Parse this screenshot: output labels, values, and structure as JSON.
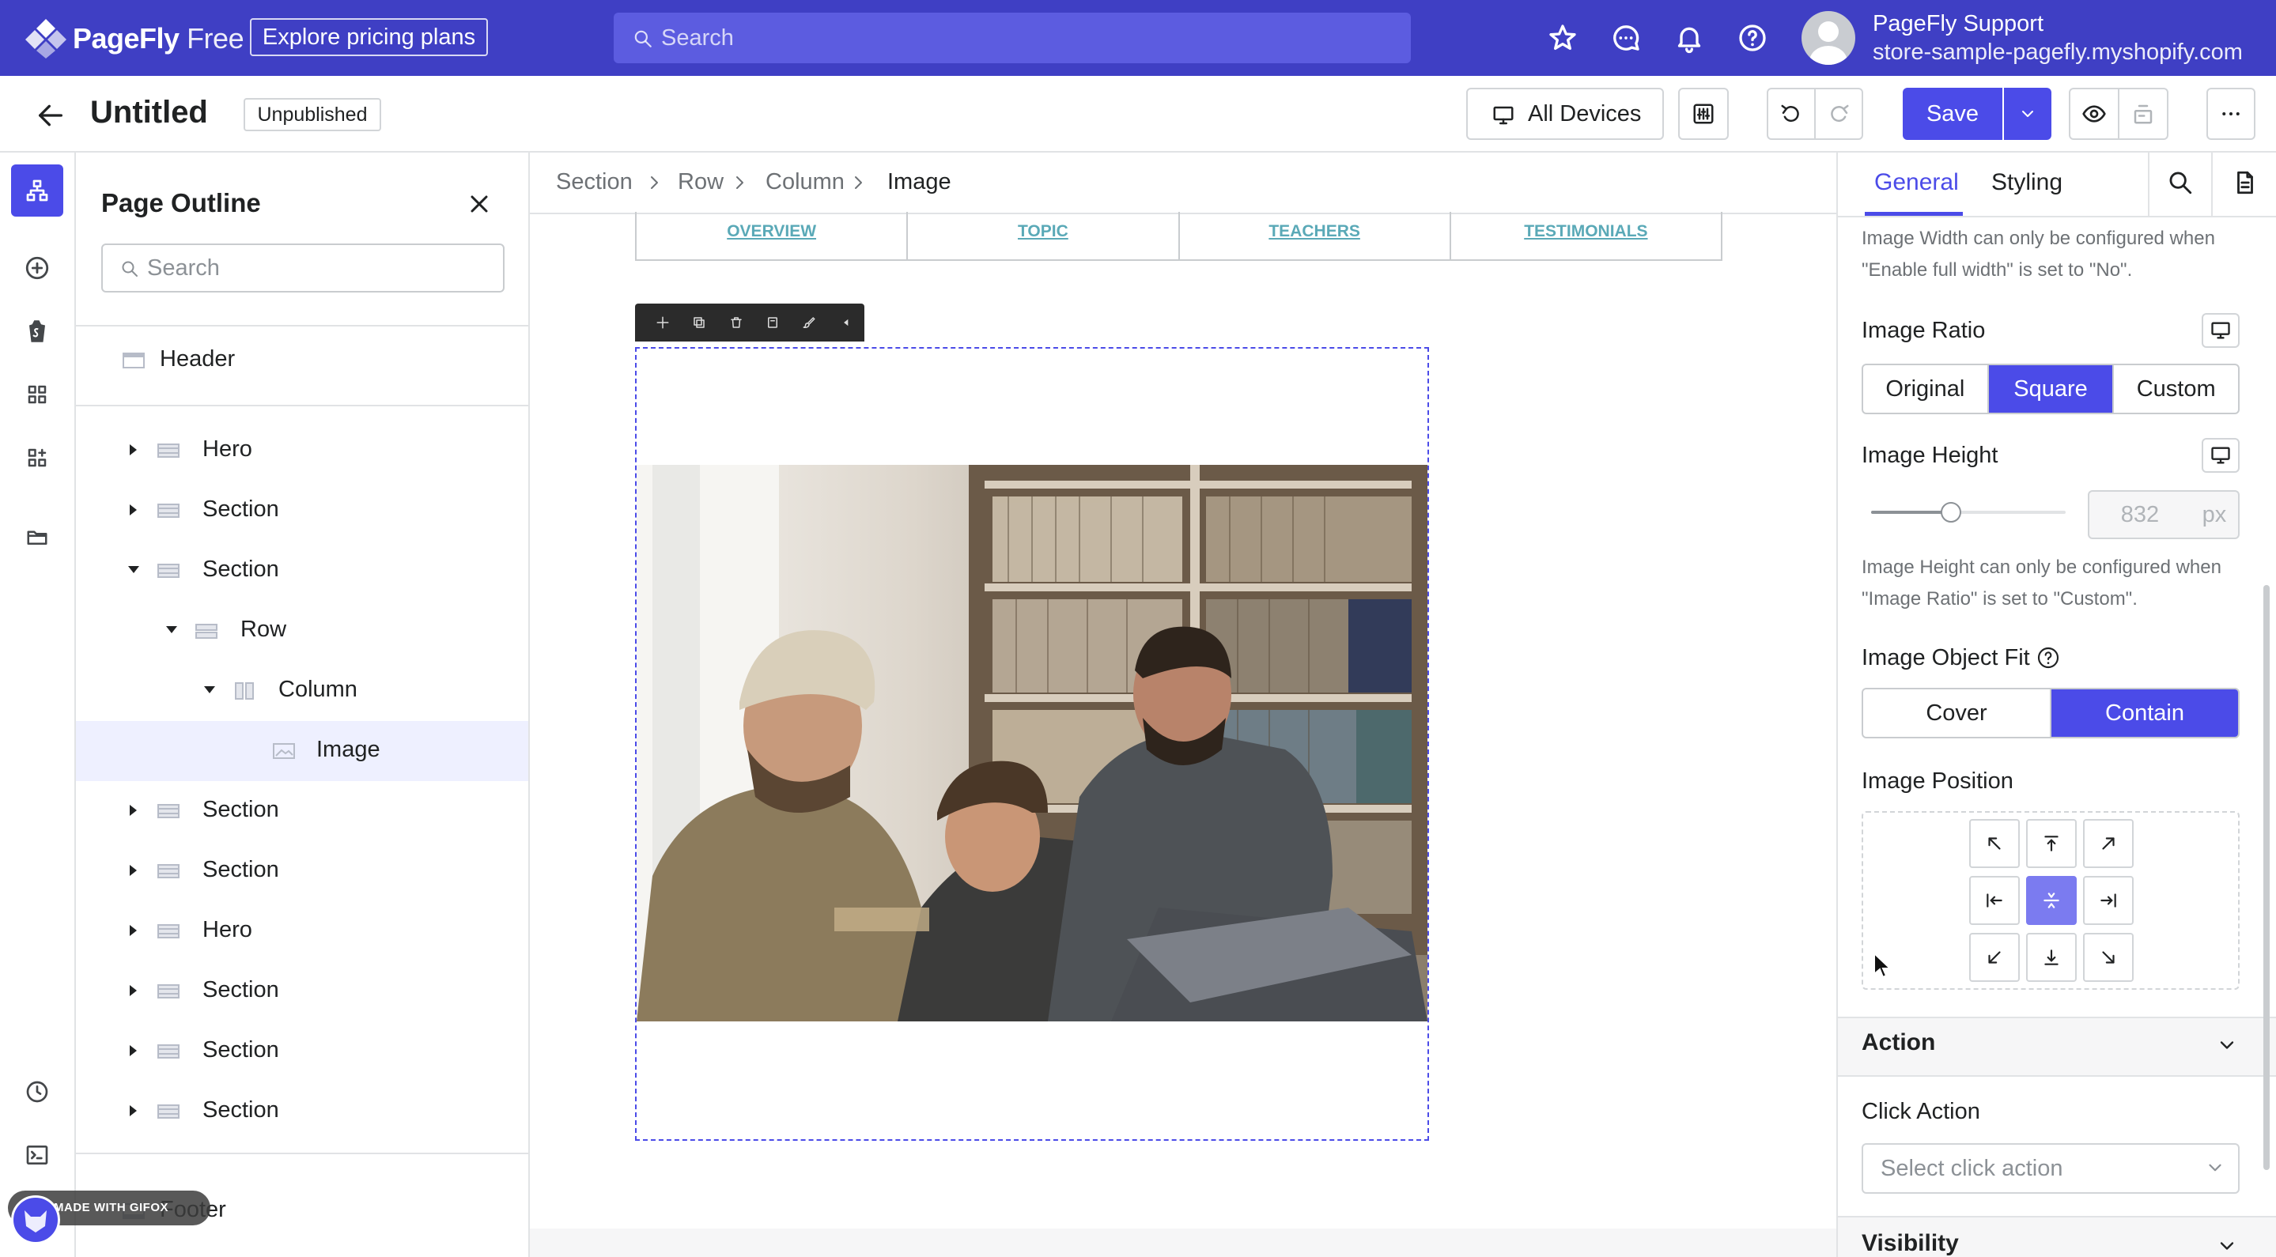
{
  "topbar": {
    "brand_name": "PageFly",
    "brand_suffix": " Free",
    "pricing_button": "Explore pricing plans",
    "search_placeholder": "Search",
    "user_name": "PageFly Support",
    "user_store": "store-sample-pagefly.myshopify.com",
    "accent_color": "#3f3fc4"
  },
  "toolbar": {
    "page_title": "Untitled",
    "status_badge": "Unpublished",
    "devices_label": "All Devices",
    "save_label": "Save"
  },
  "outline": {
    "title": "Page Outline",
    "search_placeholder": "Search",
    "items": [
      {
        "label": "Header"
      },
      {
        "label": "Hero"
      },
      {
        "label": "Section"
      },
      {
        "label": "Section"
      },
      {
        "label": "Row"
      },
      {
        "label": "Column"
      },
      {
        "label": "Image"
      },
      {
        "label": "Section"
      },
      {
        "label": "Section"
      },
      {
        "label": "Hero"
      },
      {
        "label": "Section"
      },
      {
        "label": "Section"
      },
      {
        "label": "Section"
      },
      {
        "label": "Footer"
      }
    ]
  },
  "canvas": {
    "breadcrumb": [
      "Section",
      "Row",
      "Column",
      "Image"
    ],
    "nav_tabs": [
      "OVERVIEW",
      "TOPIC",
      "TEACHERS",
      "TESTIMONIALS"
    ]
  },
  "inspector": {
    "tabs": [
      "General",
      "Styling"
    ],
    "width_hint": "Image Width can only be configured when \"Enable full width\" is set to \"No\".",
    "ratio_label": "Image Ratio",
    "ratio_options": [
      "Original",
      "Square",
      "Custom"
    ],
    "ratio_selected": "Square",
    "height_label": "Image Height",
    "height_value": "832",
    "height_unit": "px",
    "height_slider_fraction": 0.41,
    "height_hint": "Image Height can only be configured when \"Image Ratio\" is set to \"Custom\".",
    "fit_label": "Image Object Fit",
    "fit_options": [
      "Cover",
      "Contain"
    ],
    "fit_selected": "Contain",
    "position_label": "Image Position",
    "position_selected": "center",
    "action_title": "Action",
    "click_action_label": "Click Action",
    "click_action_placeholder": "Select click action",
    "visibility_title": "Visibility"
  },
  "watermark": {
    "text": "MADE WITH GIFOX"
  }
}
